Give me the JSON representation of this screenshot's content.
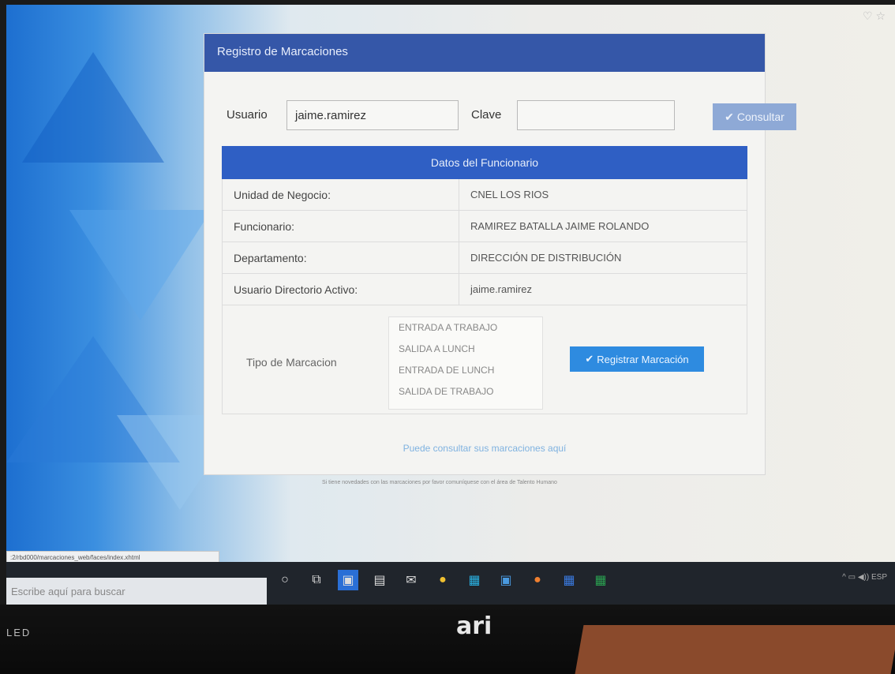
{
  "panel": {
    "title": "Registro de Marcaciones"
  },
  "login": {
    "usuario_label": "Usuario",
    "usuario_value": "jaime.ramirez",
    "clave_label": "Clave",
    "clave_value": "",
    "consultar_label": "Consultar"
  },
  "datos": {
    "header": "Datos del Funcionario",
    "rows": [
      {
        "key": "Unidad de Negocio:",
        "value": "CNEL LOS RIOS"
      },
      {
        "key": "Funcionario:",
        "value": "RAMIREZ BATALLA JAIME ROLANDO"
      },
      {
        "key": "Departamento:",
        "value": "DIRECCIÓN DE DISTRIBUCIÓN"
      },
      {
        "key": "Usuario Directorio Activo:",
        "value": "jaime.ramirez"
      }
    ]
  },
  "tipo": {
    "label": "Tipo de Marcacion",
    "options": [
      "ENTRADA A TRABAJO",
      "SALIDA A LUNCH",
      "ENTRADA DE LUNCH",
      "SALIDA DE TRABAJO"
    ],
    "registrar_label": "Registrar Marcación"
  },
  "consulta_link": "Puede consultar sus marcaciones aquí",
  "footer_note": "Si tiene novedades con las marcaciones por favor comuníquese con el área de Talento Humano",
  "statusbar_url": ":2/rbd000/marcaciones_web/faces/index.xhtml",
  "taskbar": {
    "search_placeholder": "Escribe aquí para buscar"
  },
  "monitor": {
    "brand": "ari",
    "led_label": "LED"
  }
}
